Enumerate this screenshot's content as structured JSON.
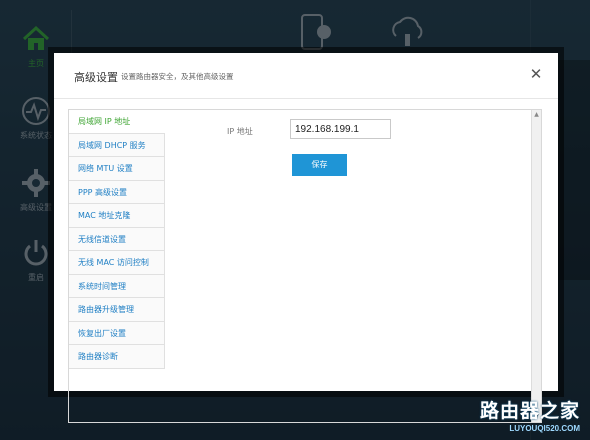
{
  "background": {
    "nav": [
      {
        "label": "主页",
        "icon": "home-icon",
        "active": true
      },
      {
        "label": "系统状态",
        "icon": "pulse-icon",
        "active": false
      },
      {
        "label": "高级设置",
        "icon": "gear-icon",
        "active": false
      },
      {
        "label": "重启",
        "icon": "power-icon",
        "active": false
      }
    ],
    "top_icons": [
      "phone-icon",
      "cloud-plug-icon"
    ]
  },
  "modal": {
    "title": "高级设置",
    "subtitle": "设置路由器安全，及其他高级设置",
    "close_glyph": "✕"
  },
  "menu": {
    "items": [
      {
        "label": "局域网 IP 地址",
        "active": true
      },
      {
        "label": "局域网 DHCP 服务",
        "active": false
      },
      {
        "label": "网络 MTU 设置",
        "active": false
      },
      {
        "label": "PPP 高级设置",
        "active": false
      },
      {
        "label": "MAC 地址克隆",
        "active": false
      },
      {
        "label": "无线信道设置",
        "active": false
      },
      {
        "label": "无线 MAC 访问控制",
        "active": false
      },
      {
        "label": "系统时间管理",
        "active": false
      },
      {
        "label": "路由器升级管理",
        "active": false
      },
      {
        "label": "恢复出厂设置",
        "active": false
      },
      {
        "label": "路由器诊断",
        "active": false
      }
    ]
  },
  "form": {
    "ip_label": "IP 地址",
    "ip_value": "192.168.199.1",
    "save_label": "保存"
  },
  "watermark": {
    "name": "路由器之家",
    "url": "LUYOUQI520.COM"
  },
  "colors": {
    "accent": "#1f95d6",
    "active_green": "#3fa534",
    "link_blue": "#1f7fc4"
  }
}
